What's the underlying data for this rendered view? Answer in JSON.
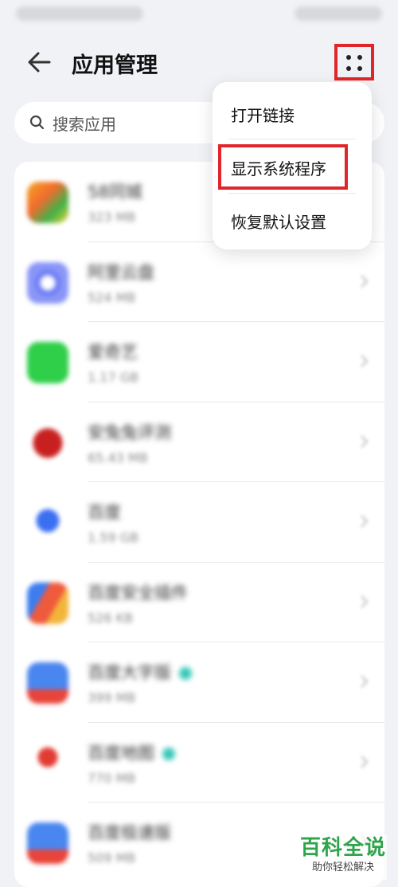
{
  "header": {
    "title": "应用管理"
  },
  "search": {
    "placeholder": "搜索应用"
  },
  "menu": {
    "items": [
      "打开链接",
      "显示系统程序",
      "恢复默认设置"
    ]
  },
  "apps": [
    {
      "name": "58同城",
      "size": "323 MB"
    },
    {
      "name": "阿里云盘",
      "size": "524 MB"
    },
    {
      "name": "爱奇艺",
      "size": "1.17 GB"
    },
    {
      "name": "安兔兔评测",
      "size": "65.43 MB"
    },
    {
      "name": "百度",
      "size": "1.59 GB"
    },
    {
      "name": "百度安全插件",
      "size": "526 KB"
    },
    {
      "name": "百度大字版",
      "size": "399 MB"
    },
    {
      "name": "百度地图",
      "size": "770 MB"
    },
    {
      "name": "百度极速版",
      "size": "509 MB"
    }
  ],
  "watermark": {
    "main": "百科全说",
    "sub": "助你轻松解决"
  },
  "colors": {
    "highlight": "#e0262a",
    "watermark": "#2fa54b"
  }
}
